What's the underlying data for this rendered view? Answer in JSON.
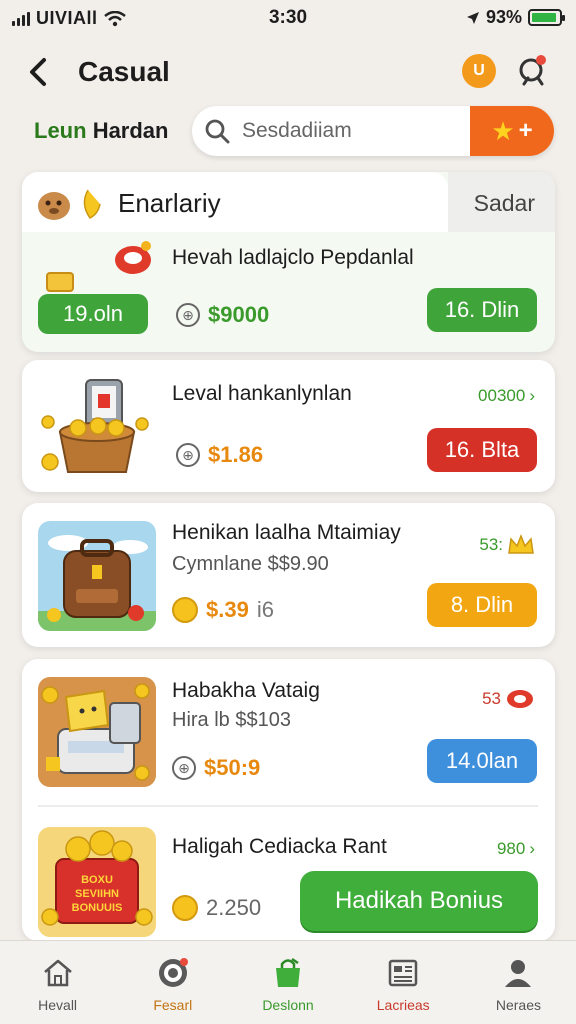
{
  "status_bar": {
    "carrier": "UIVIAll",
    "time": "3:30",
    "battery": "93%"
  },
  "header": {
    "back_label": "<",
    "title": "Casual",
    "user_badge": "U"
  },
  "filter": {
    "label_green": "Leun",
    "label_dark": "Hardan",
    "search_placeholder": "Sesdadiiam"
  },
  "featured": {
    "tab_title": "Enarlariy",
    "tab_side": "Sadar",
    "item_title": "Hevah ladlajclo Pepdanlal",
    "left_pill": "19.oln",
    "price": "$9000",
    "button": "16. Dlin"
  },
  "items": [
    {
      "title": "Leval hankanlynlan",
      "meta": "00300",
      "price": "$1.86",
      "button": "16. Blta"
    },
    {
      "title": "Henikan laalha Mtaimiay",
      "subtitle": "Cymnlane $$9.90",
      "meta": "53:",
      "price": "$.39",
      "price_suffix": "i6",
      "button": "8. Dlin"
    },
    {
      "title": "Habakha Vataig",
      "subtitle": "Hira lb $$103",
      "meta": "53",
      "price": "$50:9",
      "button": "14.0lan"
    },
    {
      "title": "Haligah Cediacka Rant",
      "meta": "980",
      "price": "2.250",
      "button": "Hadikah Bonius",
      "box_label_1": "BOXU",
      "box_label_2": "SEVIIHN",
      "box_label_3": "BONUUIS"
    }
  ],
  "nav": [
    {
      "label": "Hevall"
    },
    {
      "label": "Fesarl"
    },
    {
      "label": "Deslonn"
    },
    {
      "label": "Lacrieas"
    },
    {
      "label": "Neraes"
    }
  ],
  "colors": {
    "accent_green": "#3fa53a",
    "accent_orange": "#f0681c",
    "accent_red": "#d63126",
    "accent_blue": "#3e8fdc"
  }
}
